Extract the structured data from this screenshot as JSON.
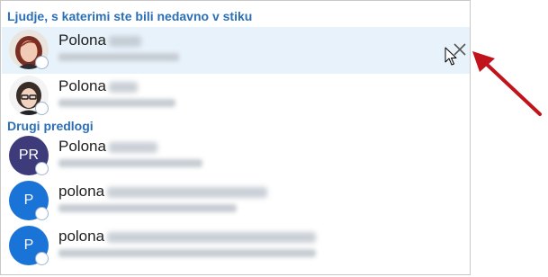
{
  "sections": {
    "recent_title": "Ljudje, s katerimi ste bili nedavno v stiku",
    "other_title": "Drugi predlogi"
  },
  "contacts": [
    {
      "name": "Polona",
      "initials": "",
      "avatar_color": ""
    },
    {
      "name": "Polona",
      "initials": "",
      "avatar_color": ""
    },
    {
      "name": "Polona",
      "initials": "PR",
      "avatar_color": "#3d3b7a"
    },
    {
      "name": "polona",
      "initials": "P",
      "avatar_color": "#1a73d6"
    },
    {
      "name": "polona",
      "initials": "P",
      "avatar_color": "#1a73d6"
    }
  ],
  "icons": {
    "remove": "close-icon",
    "pointer": "mouse-cursor-icon",
    "annotation": "red-arrow-icon",
    "presence": "presence-status-icon"
  },
  "colors": {
    "accent": "#2b6fb6",
    "selected_row": "#e8f2fb",
    "arrow": "#c0131b"
  }
}
